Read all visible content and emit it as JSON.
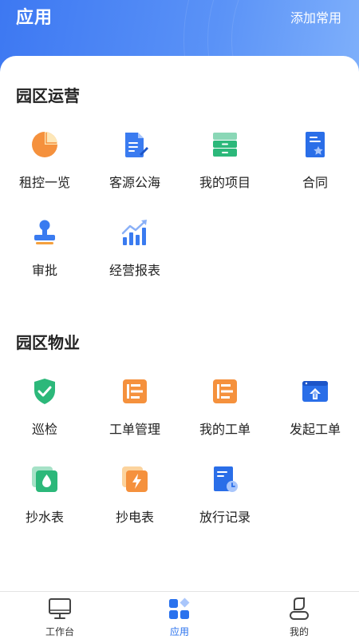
{
  "header": {
    "title": "应用",
    "add_favorites": "添加常用"
  },
  "sections": [
    {
      "title": "园区运营",
      "items": [
        {
          "label": "租控一览",
          "icon": "pie-chart-icon"
        },
        {
          "label": "客源公海",
          "icon": "document-edit-icon"
        },
        {
          "label": "我的项目",
          "icon": "drawer-icon"
        },
        {
          "label": "合同",
          "icon": "contract-star-icon"
        },
        {
          "label": "审批",
          "icon": "stamp-icon"
        },
        {
          "label": "经营报表",
          "icon": "bar-chart-trend-icon"
        }
      ]
    },
    {
      "title": "园区物业",
      "items": [
        {
          "label": "巡检",
          "icon": "shield-check-icon"
        },
        {
          "label": "工单管理",
          "icon": "work-order-icon"
        },
        {
          "label": "我的工单",
          "icon": "my-work-order-icon"
        },
        {
          "label": "发起工单",
          "icon": "create-work-order-icon"
        },
        {
          "label": "抄水表",
          "icon": "water-meter-icon"
        },
        {
          "label": "抄电表",
          "icon": "electric-meter-icon"
        },
        {
          "label": "放行记录",
          "icon": "release-record-icon"
        }
      ]
    }
  ],
  "tabbar": [
    {
      "label": "工作台",
      "icon": "monitor-icon"
    },
    {
      "label": "应用",
      "icon": "apps-icon",
      "active": true
    },
    {
      "label": "我的",
      "icon": "user-icon"
    }
  ],
  "colors": {
    "accent": "#2a72ee",
    "orange": "#f5913d",
    "green": "#2cb87a",
    "blue": "#3a7bf0"
  }
}
